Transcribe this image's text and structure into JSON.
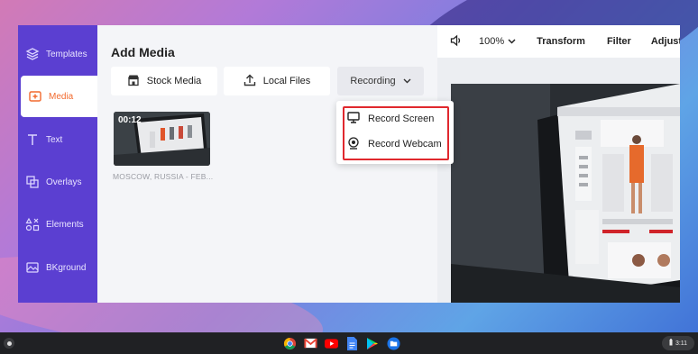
{
  "sidebar": {
    "items": [
      {
        "label": "Templates",
        "icon": "layers-icon"
      },
      {
        "label": "Media",
        "icon": "media-add-icon",
        "active": true
      },
      {
        "label": "Text",
        "icon": "text-icon"
      },
      {
        "label": "Overlays",
        "icon": "overlays-icon"
      },
      {
        "label": "Elements",
        "icon": "elements-icon"
      },
      {
        "label": "BKground",
        "icon": "background-icon"
      }
    ],
    "bg_color": "#5b3fd1",
    "active_color": "#f26a2e"
  },
  "panel": {
    "title": "Add Media",
    "stock_label": "Stock Media",
    "local_label": "Local Files",
    "recording_label": "Recording",
    "media_item": {
      "duration": "00:12",
      "caption": "MOSCOW, RUSSIA - FEB..."
    }
  },
  "recording_menu": {
    "record_screen": "Record Screen",
    "record_webcam": "Record Webcam",
    "highlight_color": "#e0282e"
  },
  "toolbar": {
    "zoom": "100%",
    "transform": "Transform",
    "filter": "Filter",
    "adjust": "Adjust"
  },
  "taskbar": {
    "apps": [
      "chrome-icon",
      "gmail-icon",
      "youtube-icon",
      "docs-icon",
      "play-store-icon",
      "files-icon"
    ],
    "time": "3:11"
  }
}
